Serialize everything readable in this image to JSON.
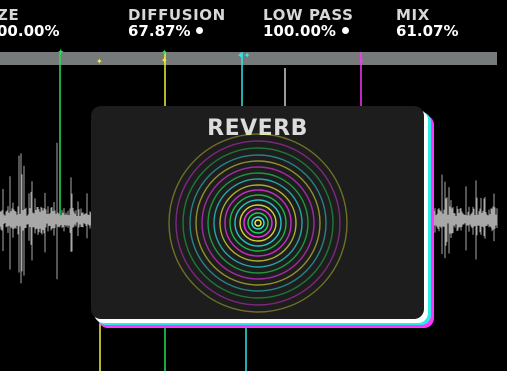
{
  "params": [
    {
      "name": "ZE",
      "value": "00.00%",
      "dot": false
    },
    {
      "name": "DIFFUSION",
      "value": "67.87%",
      "dot": true
    },
    {
      "name": "LOW PASS",
      "value": "100.00%",
      "dot": true
    },
    {
      "name": "MIX",
      "value": "61.07%",
      "dot": false
    }
  ],
  "popup": {
    "title": "REVERB"
  },
  "colors": {
    "green": "#22e05a",
    "yellow": "#f2f23a",
    "cyan": "#2ee9e9",
    "magenta": "#ff36ff",
    "white": "#ffffff",
    "timeline": "#777a7a",
    "popup_bg": "#1d1d1d"
  }
}
